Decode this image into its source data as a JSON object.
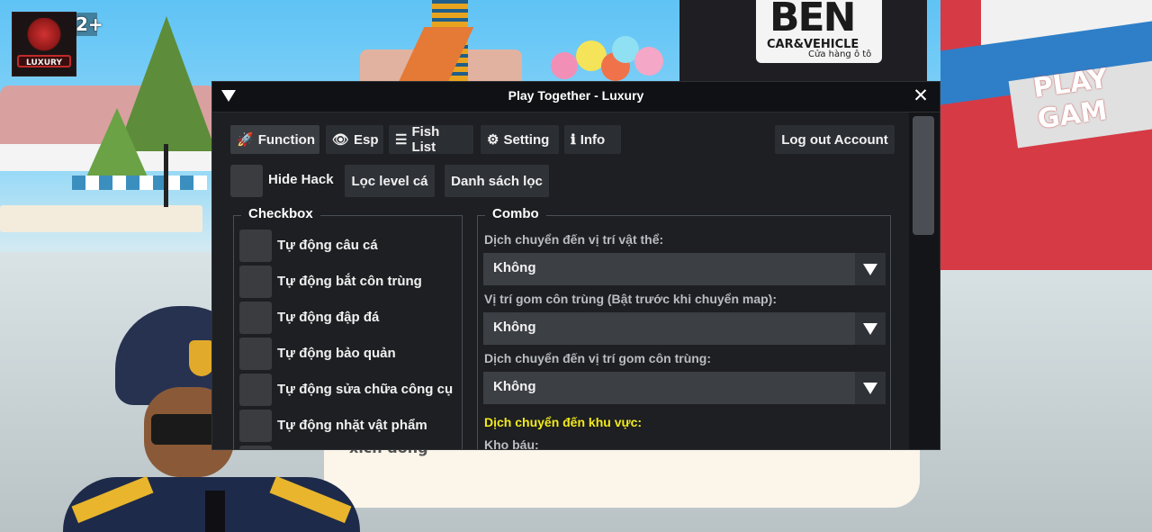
{
  "game": {
    "age_rating": "2+",
    "logo_text": "LUXURY",
    "shop_sign": "BEN",
    "shop_sub": "CAR&VEHICLE",
    "shop_sub2": "Cửa hàng ô tô",
    "play_sign": "PLAY GAM",
    "npc_text": "xích đông"
  },
  "window": {
    "title": "Play Together - Luxury",
    "close_glyph": "✕"
  },
  "tabs": [
    {
      "label": "Function",
      "icon": "rocket-icon",
      "glyph": "🚀"
    },
    {
      "label": "Esp",
      "icon": "eye-icon",
      "glyph": "👁"
    },
    {
      "label": "Fish List",
      "icon": "list-icon",
      "glyph": "☰"
    },
    {
      "label": "Setting",
      "icon": "gear-icon",
      "glyph": "⚙"
    },
    {
      "label": "Info",
      "icon": "info-icon",
      "glyph": "ℹ"
    }
  ],
  "logout_label": "Log out Account",
  "toolbar": {
    "hide_hack_label": "Hide Hack",
    "filter_level_label": "Lọc level cá",
    "filter_list_label": "Danh sách lọc"
  },
  "checkbox_group": {
    "title": "Checkbox",
    "items": [
      {
        "label": "Tự động câu cá",
        "checked": false
      },
      {
        "label": "Tự động bắt côn trùng",
        "checked": false
      },
      {
        "label": "Tự động đập đá",
        "checked": false
      },
      {
        "label": "Tự động bảo quản",
        "checked": false
      },
      {
        "label": "Tự động sửa chữa công cụ",
        "checked": false
      },
      {
        "label": "Tự động nhặt vật phẩm",
        "checked": false
      }
    ]
  },
  "combo_group": {
    "title": "Combo",
    "fields": [
      {
        "label": "Dịch chuyển đến vị trí vật thể:",
        "value": "Không"
      },
      {
        "label": "Vị trí gom côn trùng (Bật trước khi chuyển map):",
        "value": "Không"
      },
      {
        "label": "Dịch chuyển đến vị trí gom côn trùng:",
        "value": "Không"
      }
    ],
    "area_heading": "Dịch chuyển đến khu vực:",
    "area_sub": "Kho báu:",
    "heading_color": "#f2ea1b"
  }
}
